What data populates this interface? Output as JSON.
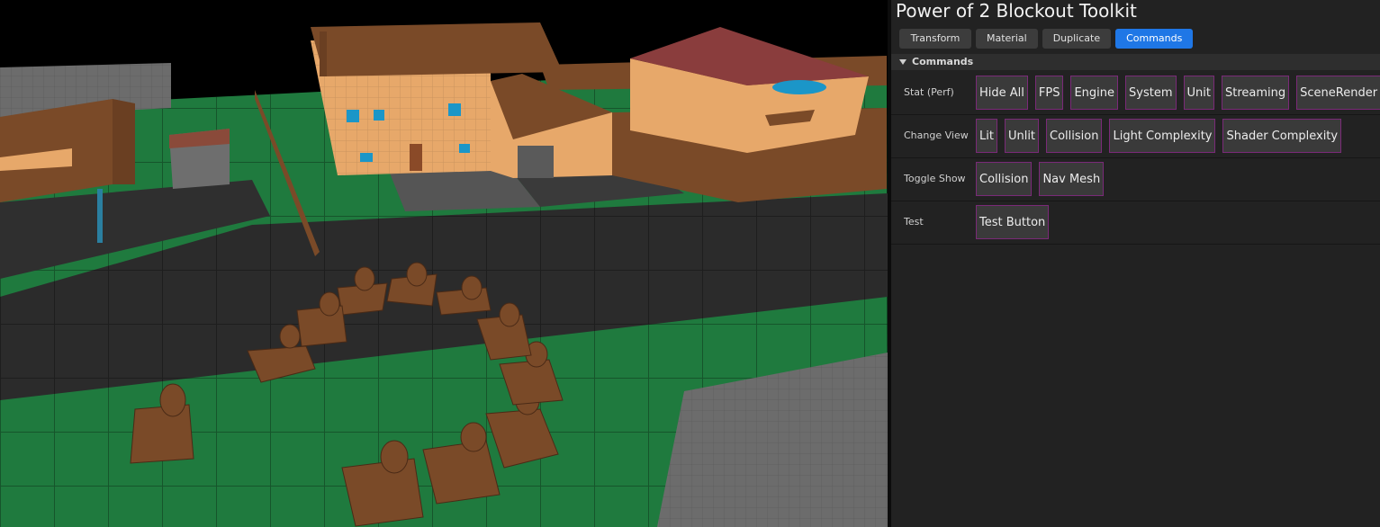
{
  "panel": {
    "title": "Power of 2 Blockout Toolkit",
    "tabs": [
      {
        "label": "Transform",
        "active": false
      },
      {
        "label": "Material",
        "active": false
      },
      {
        "label": "Duplicate",
        "active": false
      },
      {
        "label": "Commands",
        "active": true
      }
    ],
    "section": {
      "label": "Commands",
      "expanded": true
    },
    "rows": [
      {
        "label": "Stat (Perf)",
        "buttons": [
          "Hide All",
          "FPS",
          "Engine",
          "System",
          "Unit",
          "Streaming",
          "SceneRender"
        ]
      },
      {
        "label": "Change View",
        "buttons": [
          "Lit",
          "Unlit",
          "Collision",
          "Light Complexity",
          "Shader Complexity"
        ]
      },
      {
        "label": "Toggle Show",
        "buttons": [
          "Collision",
          "Nav Mesh"
        ]
      },
      {
        "label": "Test",
        "buttons": [
          "Test Button"
        ]
      }
    ]
  },
  "colors": {
    "accent_tab": "#1f77e6",
    "button_border": "#7a2a78",
    "grass": "#1e7a3c",
    "road": "#2a2a2a",
    "wall": "#e7a86a",
    "roof": "#7a4a28"
  }
}
